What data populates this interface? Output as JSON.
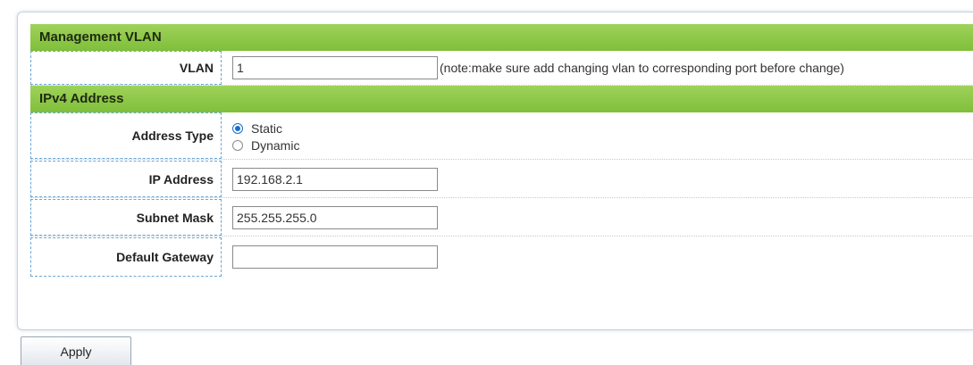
{
  "sections": {
    "management_vlan": "Management VLAN",
    "ipv4_address": "IPv4 Address"
  },
  "vlan": {
    "label": "VLAN",
    "value": "1",
    "note": "(note:make sure add changing vlan to corresponding port before change)"
  },
  "address_type": {
    "label": "Address Type",
    "options": [
      {
        "label": "Static",
        "selected": true
      },
      {
        "label": "Dynamic",
        "selected": false
      }
    ]
  },
  "ip_address": {
    "label": "IP Address",
    "value": "192.168.2.1"
  },
  "subnet_mask": {
    "label": "Subnet Mask",
    "value": "255.255.255.0"
  },
  "default_gateway": {
    "label": "Default Gateway",
    "value": ""
  },
  "buttons": {
    "apply": "Apply"
  },
  "colors": {
    "section_header": "#8cc84b",
    "radio_selected": "#1a6fc9"
  }
}
